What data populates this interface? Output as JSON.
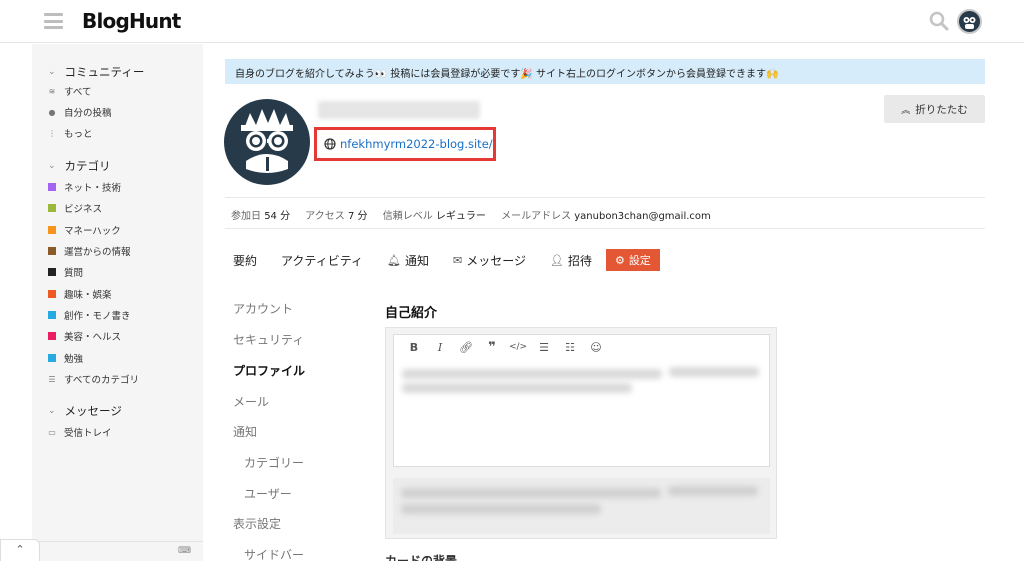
{
  "header": {
    "logo": "BlogHunt"
  },
  "sidebar": {
    "sections": [
      {
        "label": "コミュニティー"
      },
      {
        "label": "カテゴリ"
      },
      {
        "label": "メッセージ"
      }
    ],
    "community_items": [
      {
        "label": "すべて",
        "icon": "layers-icon"
      },
      {
        "label": "自分の投稿",
        "icon": "user-icon"
      },
      {
        "label": "もっと",
        "icon": "more-vertical-icon"
      }
    ],
    "categories": [
      {
        "label": "ネット・技術",
        "color": "#a463f2"
      },
      {
        "label": "ビジネス",
        "color": "#9cb83c"
      },
      {
        "label": "マネーハック",
        "color": "#f7941d"
      },
      {
        "label": "運営からの情報",
        "color": "#8b5a2b"
      },
      {
        "label": "質問",
        "color": "#222222"
      },
      {
        "label": "趣味・娯楽",
        "color": "#ee5a24"
      },
      {
        "label": "創作・モノ書き",
        "color": "#25aae1"
      },
      {
        "label": "美容・ヘルス",
        "color": "#e91e63"
      },
      {
        "label": "勉強",
        "color": "#25aae1"
      },
      {
        "label": "すべてのカテゴリ",
        "icon": "list-icon"
      }
    ],
    "message_items": [
      {
        "label": "受信トレイ",
        "icon": "inbox-icon"
      }
    ]
  },
  "banner": {
    "text": "自身のブログを紹介してみよう👀 投稿には会員登録が必要です🎉 サイト右上のログインボタンから会員登録できます🙌"
  },
  "profile": {
    "website": "nfekhmyrm2022-blog.site/",
    "collapse_label": "折りたたむ"
  },
  "stats": {
    "joined_label": "参加日",
    "joined_value": "54 分",
    "access_label": "アクセス",
    "access_value": "7 分",
    "trust_label": "信頼レベル",
    "trust_value": "レギュラー",
    "email_label": "メールアドレス",
    "email_value": "yanubon3chan@gmail.com"
  },
  "tabs": [
    {
      "label": "要約"
    },
    {
      "label": "アクティビティ"
    },
    {
      "label": "通知",
      "icon": "bell-icon"
    },
    {
      "label": "メッセージ",
      "icon": "envelope-icon"
    },
    {
      "label": "招待",
      "icon": "user-plus-icon"
    },
    {
      "label": "設定",
      "icon": "gear-icon",
      "active": true
    }
  ],
  "settings_nav": [
    {
      "label": "アカウント"
    },
    {
      "label": "セキュリティ"
    },
    {
      "label": "プロファイル",
      "active": true
    },
    {
      "label": "メール"
    },
    {
      "label": "通知"
    },
    {
      "label": "カテゴリー",
      "indent": true
    },
    {
      "label": "ユーザー",
      "indent": true
    },
    {
      "label": "表示設定"
    },
    {
      "label": "サイドバー",
      "indent": true
    }
  ],
  "bio": {
    "title": "自己紹介",
    "toolbar": [
      "B",
      "I",
      "link",
      "quote",
      "code",
      "bullet-list",
      "numbered-list",
      "emoji"
    ]
  },
  "next_section_title": "カードの背景"
}
